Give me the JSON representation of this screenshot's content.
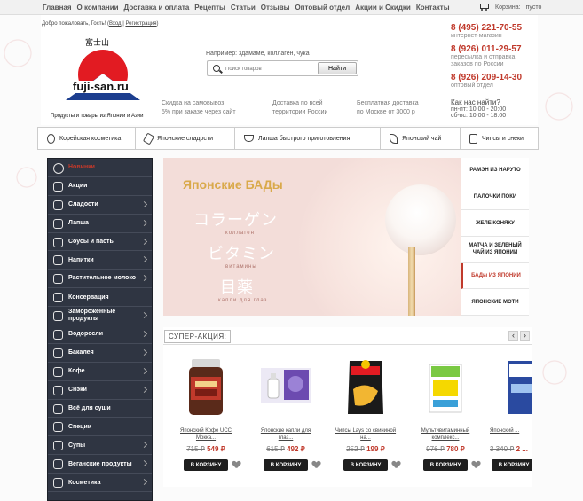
{
  "topnav": {
    "items": [
      "Главная",
      "О компании",
      "Доставка и оплата",
      "Рецепты",
      "Статьи",
      "Отзывы",
      "Оптовый отдел",
      "Акции и Скидки",
      "Контакты"
    ],
    "cart_label": "Корзина:",
    "cart_value": "пусто"
  },
  "header": {
    "welcome": "Добро пожаловать, Гость!",
    "login": "Вход",
    "register": "Регистрация",
    "logo_kanji": "富士山",
    "logo_name": "fuji-san.ru",
    "tagline": "Продукты и товары из Японии и Азии",
    "search_example": "Например: здамаме, коллаген, чука",
    "search_placeholder": "Поиск товаров",
    "search_button": "Найти",
    "features": [
      {
        "line1": "Скидка на самовывоз",
        "line2": "5% при заказе через сайт"
      },
      {
        "line1": "Доставка по всей",
        "line2": "территории России"
      },
      {
        "line1": "Бесплатная доставка",
        "line2": "по Москве от 3000 р"
      }
    ],
    "phones": [
      {
        "number": "8 (495) 221-70-55",
        "note": "интернет-магазин",
        "note2": ""
      },
      {
        "number": "8 (926) 011-29-57",
        "note": "пересылка и отправка",
        "note2": "заказов по России"
      },
      {
        "number": "8 (926) 209-14-30",
        "note": "оптовый отдел",
        "note2": ""
      }
    ],
    "how_to_find": "Как нас найти?",
    "hours1": "пн-пт: 10:00 - 20:00",
    "hours2": "сб-вс: 10:00 - 18:00"
  },
  "categories": [
    "Корейская косметика",
    "Японские сладости",
    "Лапша быстрого приготовления",
    "Японский чай",
    "Чипсы и снеки"
  ],
  "sidebar": {
    "items": [
      {
        "label": "Новинки",
        "arrow": false,
        "icon": "new-icon"
      },
      {
        "label": "Акции",
        "arrow": false,
        "icon": "sale-icon"
      },
      {
        "label": "Сладости",
        "arrow": true,
        "icon": "sweets-icon"
      },
      {
        "label": "Лапша",
        "arrow": true,
        "icon": "noodles-icon"
      },
      {
        "label": "Соусы и пасты",
        "arrow": true,
        "icon": "sauce-icon"
      },
      {
        "label": "Напитки",
        "arrow": true,
        "icon": "drink-icon"
      },
      {
        "label": "Растительное молоко",
        "arrow": true,
        "icon": "milk-icon"
      },
      {
        "label": "Консервация",
        "arrow": false,
        "icon": "can-icon"
      },
      {
        "label": "Замороженные продукты",
        "arrow": true,
        "icon": "snowflake-icon"
      },
      {
        "label": "Водоросли",
        "arrow": true,
        "icon": "seaweed-icon"
      },
      {
        "label": "Бакалея",
        "arrow": true,
        "icon": "grocery-icon"
      },
      {
        "label": "Кофе",
        "arrow": true,
        "icon": "coffee-icon"
      },
      {
        "label": "Снэки",
        "arrow": true,
        "icon": "snack-icon"
      },
      {
        "label": "Всё для суши",
        "arrow": false,
        "icon": "sushi-icon"
      },
      {
        "label": "Специи",
        "arrow": false,
        "icon": "spice-icon"
      },
      {
        "label": "Супы",
        "arrow": true,
        "icon": "soup-icon"
      },
      {
        "label": "Веганские продукты",
        "arrow": true,
        "icon": "vegan-icon"
      },
      {
        "label": "Косметика",
        "arrow": true,
        "icon": "cosmetics-icon"
      }
    ]
  },
  "banner": {
    "title": "Японские БАДы",
    "jp1": "コラーゲン",
    "sub1": "коллаген",
    "jp2": "ビタミン",
    "sub2": "витамины",
    "jp3": "目薬",
    "sub3": "капли для глаз"
  },
  "banner_tabs": [
    "РАМЭН ИЗ НАРУТО",
    "ПАЛОЧКИ ПОКИ",
    "ЖЕЛЕ КОНЯКУ",
    "МАТЧА И ЗЕЛЕНЫЙ ЧАЙ ИЗ ЯПОНИИ",
    "БАДы ИЗ ЯПОНИИ",
    "ЯПОНСКИЕ МОТИ"
  ],
  "promo": {
    "title": "СУПЕР-АКЦИЯ:",
    "buy_label": "В КОРЗИНУ",
    "products": [
      {
        "name": "Японский Кофе UCC",
        "name2": "Мокка...",
        "old": "715 ₽",
        "new": "549 ₽"
      },
      {
        "name": "Японские капли для",
        "name2": "глаз...",
        "old": "615 ₽",
        "new": "492 ₽"
      },
      {
        "name": "Чипсы Lays со свининой",
        "name2": "на...",
        "old": "252 ₽",
        "new": "199 ₽"
      },
      {
        "name": "Мультивитаминный",
        "name2": "комплекс...",
        "old": "976 ₽",
        "new": "780 ₽"
      },
      {
        "name": "Японский ...",
        "name2": "",
        "old": "3 340 ₽",
        "new": "2 ..."
      }
    ]
  },
  "colors": {
    "accent": "#c0392b",
    "sidebar": "#2f3542"
  }
}
